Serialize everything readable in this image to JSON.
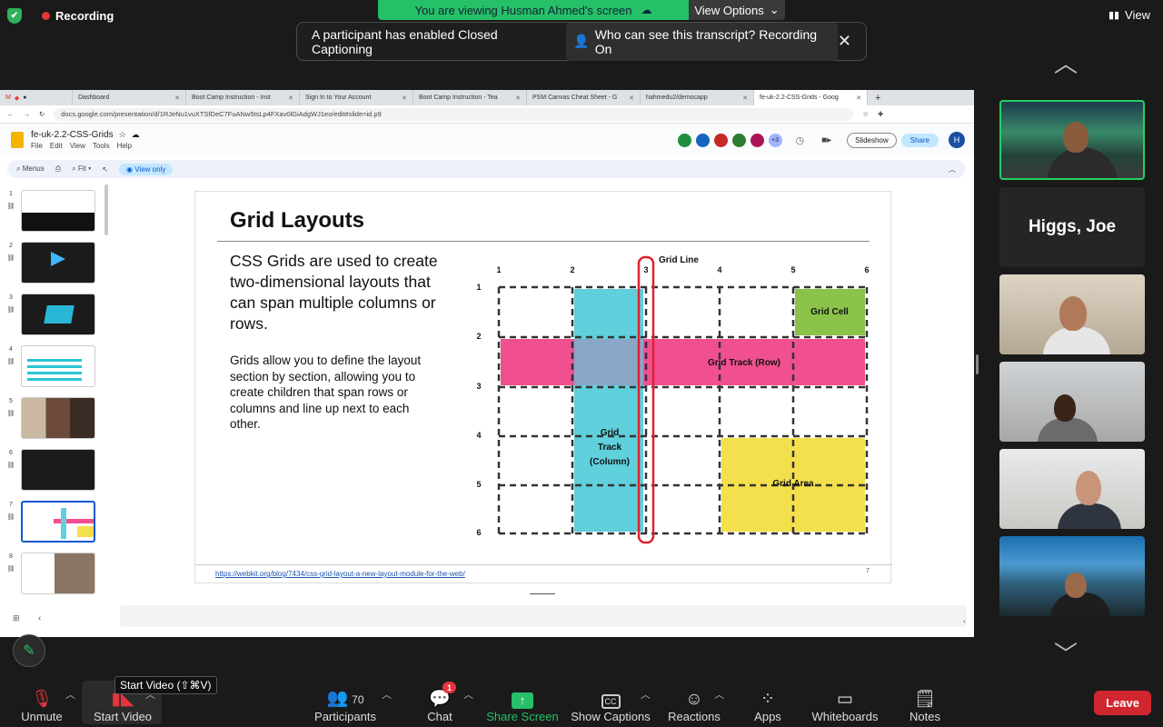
{
  "top": {
    "recording_label": "Recording",
    "view_label": "View",
    "viewing_text": "You are viewing Husman Ahmed's screen",
    "view_options_label": "View Options",
    "cc_banner_text": "A participant has enabled Closed Captioning",
    "cc_who_text": "Who can see this transcript? Recording On"
  },
  "browser": {
    "tabs": [
      "Dashboard",
      "Boot Camp Instruction - Inst",
      "Sign In to Your Account",
      "Boot Camp Instruction - Tea",
      "PSM Canvas Cheat Sheet - G",
      "hahmedu2/democapp",
      "fe-uk-2.2-CSS-Grids - Goog"
    ],
    "url": "docs.google.com/presentation/d/1RJeNu1vuXTSfDeC7FuANw5tsLp4FXav0lGiAdgWJ1eo/edit#slide=id.p9"
  },
  "doc": {
    "name": "fe-uk-2.2-CSS-Grids",
    "menu": [
      "File",
      "Edit",
      "View",
      "Tools",
      "Help"
    ],
    "toolbar": {
      "menus": "Menus",
      "zoom": "Fit",
      "view_only": "View only"
    },
    "extra_viewers": "+3",
    "slideshow": "Slideshow",
    "share": "Share",
    "avatar_initial": "H",
    "slide_numbers": [
      "1",
      "2",
      "3",
      "4",
      "5",
      "6",
      "7",
      "8"
    ],
    "selected_slide": 7
  },
  "slide": {
    "title": "Grid Layouts",
    "bullet1": "CSS Grids are used to create two-dimensional layouts that can span multiple columns or rows.",
    "bullet2": "Grids allow you to define the layout section by section, allowing you to create children that span rows or columns and line up next to each other.",
    "link": "https://webkit.org/blog/7434/css-grid-layout-a-new-layout-module-for-the-web/",
    "page_number": "7",
    "diagram": {
      "grid_line_label": "Grid Line",
      "column_numbers": [
        "1",
        "2",
        "3",
        "4",
        "5",
        "6"
      ],
      "row_numbers": [
        "1",
        "2",
        "3",
        "4",
        "5",
        "6"
      ],
      "cell_label": "Grid Cell",
      "track_row_label": "Grid Track (Row)",
      "track_col_label": [
        "Grid",
        "Track",
        "(Column)"
      ],
      "area_label": "Grid Area",
      "colors": {
        "cell": "#8bc34a",
        "row": "#f0508f",
        "column": "#5fd0dc",
        "area": "#f4e04d",
        "line": "#e0202e"
      }
    }
  },
  "participants": [
    {
      "name": "",
      "active_speaker": true
    },
    {
      "name": "Higgs, Joe"
    },
    {
      "name": ""
    },
    {
      "name": ""
    },
    {
      "name": ""
    },
    {
      "name": ""
    }
  ],
  "controls": {
    "unmute": "Unmute",
    "start_video": "Start Video",
    "tooltip": "Start Video (⇧⌘V)",
    "participants": "Participants",
    "participant_count": "70",
    "chat": "Chat",
    "chat_badge": "1",
    "share_screen": "Share Screen",
    "show_captions": "Show Captions",
    "reactions": "Reactions",
    "apps": "Apps",
    "whiteboards": "Whiteboards",
    "notes": "Notes",
    "leave": "Leave"
  },
  "colors": {
    "zoom_green": "#26c069",
    "leave_red": "#d0262f"
  }
}
